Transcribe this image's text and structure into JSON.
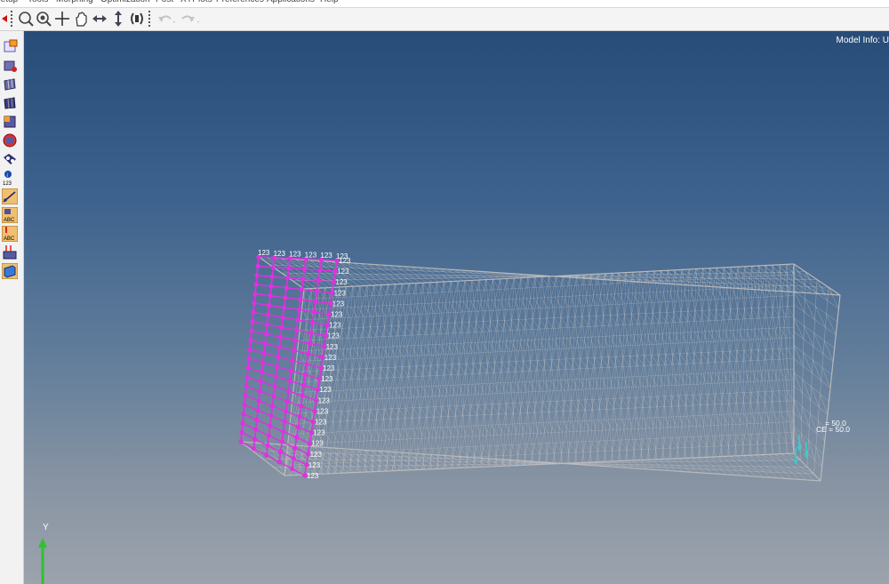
{
  "menu": [
    {
      "label": "Setup"
    },
    {
      "label": "Tools"
    },
    {
      "label": "Morphing"
    },
    {
      "label": "Optimization"
    },
    {
      "label": "Post"
    },
    {
      "label": "XYPlots"
    },
    {
      "label": "Preferences"
    },
    {
      "label": "Applications"
    },
    {
      "label": "Help"
    }
  ],
  "toolbar_icons": [
    "zoom-window-icon",
    "zoom-circle-icon",
    "rotate-center-icon",
    "pan-hand-icon",
    "horizontal-arrows-icon",
    "vertical-arrows-icon",
    "rotate-free-icon",
    "undo-icon",
    "redo-icon"
  ],
  "left_toolbar_icons": [
    "component-edit-icon",
    "component-color-icon",
    "mesh-display-icon",
    "shaded-mesh-icon",
    "elements-icon",
    "sphere-icon",
    "visibility-icon",
    "info-numbers-icon",
    "edge-icon",
    "label-abc-icon",
    "label-abc-red-icon",
    "loads-icon",
    "cube-icon"
  ],
  "viewport": {
    "model_info": "Model Info: U",
    "constraint_label": "123",
    "load_text_1": "= 50.0",
    "load_text_2": "CE = 50.0",
    "axis_y": "Y"
  },
  "colors": {
    "constraint": "#e030e0",
    "mesh": "#c8c8c8",
    "load": "#3ec8d0",
    "axis": "#30c030"
  }
}
